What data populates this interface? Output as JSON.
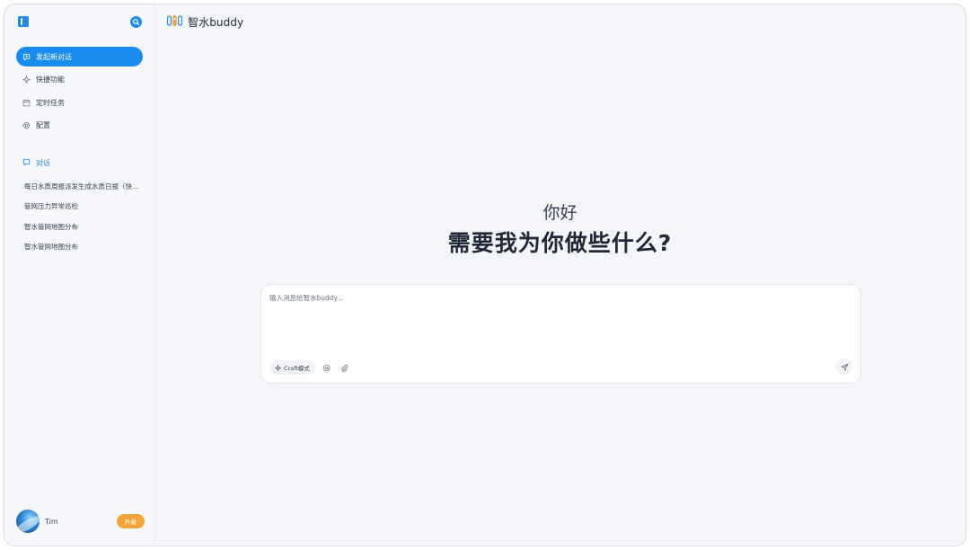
{
  "app": {
    "brand_name": "智水buddy"
  },
  "sidebar": {
    "nav": [
      {
        "label": "发起新对话",
        "icon": "chat-plus-icon"
      },
      {
        "label": "快捷功能",
        "icon": "sparkle-icon"
      },
      {
        "label": "定时任务",
        "icon": "calendar-icon"
      },
      {
        "label": "配置",
        "icon": "gear-icon"
      }
    ],
    "section_title": "对话",
    "conversations": [
      "每日水质周报派发生成水质日报（快捷功能）",
      "管网压力异常巡检",
      "智水管网地图分布",
      "智水管网地图分布"
    ],
    "user_name": "Tim",
    "upgrade_label": "升级"
  },
  "main": {
    "greeting_small": "你好",
    "greeting_big": "需要我为你做些什么?",
    "composer": {
      "placeholder": "输入消息给智水buddy...",
      "value": "",
      "craft_label": "Craft模式"
    }
  },
  "colors": {
    "accent": "#1a8cf0",
    "upgrade": "#f4a335",
    "background": "#f3f5f9"
  }
}
